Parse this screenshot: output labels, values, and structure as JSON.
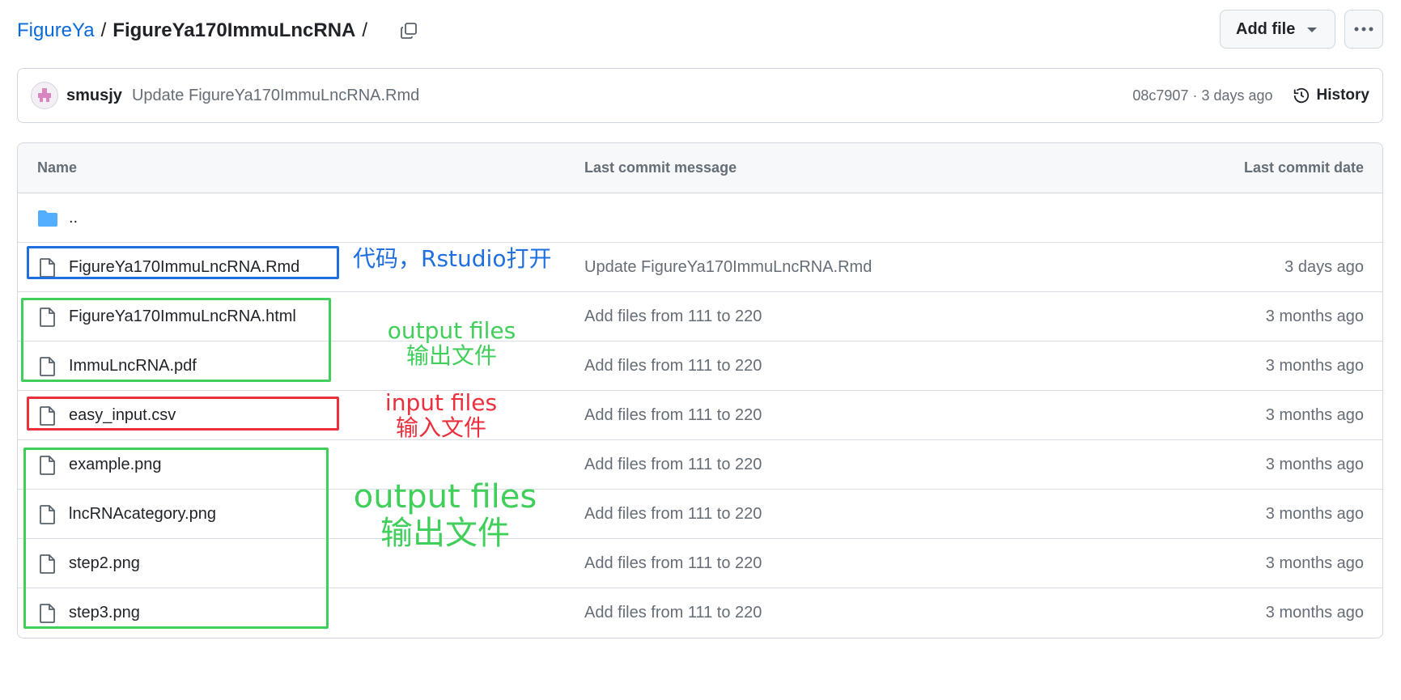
{
  "breadcrumb": {
    "repo": "FigureYa",
    "separator": "/",
    "current": "FigureYa170ImmuLncRNA",
    "trailing": "/"
  },
  "toolbar": {
    "add_file_label": "Add file",
    "more_icon": "kebab-horizontal-icon"
  },
  "commit": {
    "author": "smusjy",
    "message": "Update FigureYa170ImmuLncRNA.Rmd",
    "sha_time": "08c7907 · 3 days ago",
    "history_label": "History"
  },
  "table": {
    "headers": {
      "name": "Name",
      "message": "Last commit message",
      "date": "Last commit date"
    },
    "parent": "..",
    "rows": [
      {
        "name": "FigureYa170ImmuLncRNA.Rmd",
        "message": "Update FigureYa170ImmuLncRNA.Rmd",
        "date": "3 days ago"
      },
      {
        "name": "FigureYa170ImmuLncRNA.html",
        "message": "Add files from 111 to 220",
        "date": "3 months ago"
      },
      {
        "name": "ImmuLncRNA.pdf",
        "message": "Add files from 111 to 220",
        "date": "3 months ago"
      },
      {
        "name": "easy_input.csv",
        "message": "Add files from 111 to 220",
        "date": "3 months ago"
      },
      {
        "name": "example.png",
        "message": "Add files from 111 to 220",
        "date": "3 months ago"
      },
      {
        "name": "lncRNAcategory.png",
        "message": "Add files from 111 to 220",
        "date": "3 months ago"
      },
      {
        "name": "step2.png",
        "message": "Add files from 111 to 220",
        "date": "3 months ago"
      },
      {
        "name": "step3.png",
        "message": "Add files from 111 to 220",
        "date": "3 months ago"
      }
    ]
  },
  "annotations": {
    "code": "代码，Rstudio打开",
    "output_small_en": "output files",
    "output_small_zh": "输出文件",
    "input_en": "input files",
    "input_zh": "输入文件",
    "output_large_en": "output files",
    "output_large_zh": "输出文件"
  },
  "colors": {
    "link": "#0969da",
    "annotation_blue": "#1f6fe0",
    "annotation_green": "#3fcf5a",
    "annotation_red": "#ec2f3c",
    "folder": "#54aeff"
  }
}
